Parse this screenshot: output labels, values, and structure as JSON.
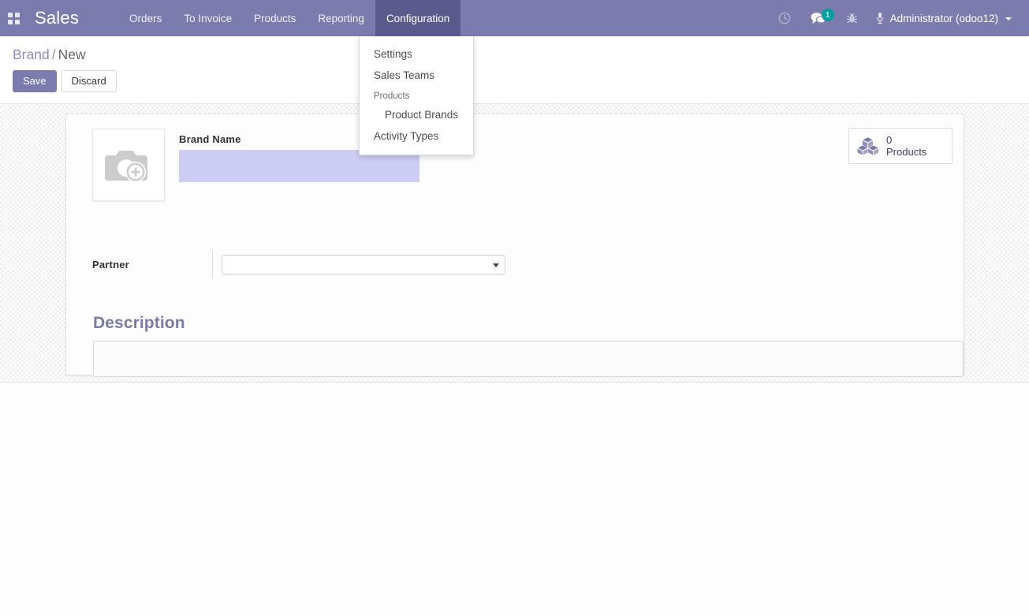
{
  "navbar": {
    "apps_icon": "apps-grid-icon",
    "app_title": "Sales",
    "menu": [
      {
        "label": "Orders",
        "active": false
      },
      {
        "label": "To Invoice",
        "active": false
      },
      {
        "label": "Products",
        "active": false
      },
      {
        "label": "Reporting",
        "active": false
      },
      {
        "label": "Configuration",
        "active": true
      }
    ],
    "systray": {
      "clock_icon": "clock-icon",
      "messages_icon": "messages-icon",
      "messages_count": "1",
      "bug_icon": "bug-icon",
      "user_icon": "user-icon",
      "user_label": "Administrator (odoo12)",
      "caret_icon": "chevron-down-icon"
    },
    "colors": {
      "navbar_bg": "#7c7bad",
      "active_menu_bg": "#5b5a8d",
      "badge_bg": "#00a09d"
    }
  },
  "dropdown": {
    "open_for": "Configuration",
    "items": [
      {
        "label": "Settings",
        "type": "item"
      },
      {
        "label": "Sales Teams",
        "type": "item"
      },
      {
        "label": "Products",
        "type": "header"
      },
      {
        "label": "Product Brands",
        "type": "sub"
      },
      {
        "label": "Activity Types",
        "type": "item"
      }
    ]
  },
  "control_panel": {
    "breadcrumb": {
      "parent": "Brand",
      "separator": "/",
      "current": "New"
    },
    "buttons": {
      "save": "Save",
      "discard": "Discard"
    }
  },
  "form": {
    "stat_button": {
      "icon": "cubes-icon",
      "value": "0",
      "label": "Products"
    },
    "image_placeholder": {
      "icon": "camera-plus-icon"
    },
    "brand_name": {
      "label": "Brand Name",
      "value": "",
      "placeholder": ""
    },
    "partner": {
      "label": "Partner",
      "value": "",
      "caret_icon": "chevron-down-icon"
    },
    "description": {
      "title": "Description",
      "value": "",
      "placeholder": ""
    },
    "colors": {
      "highlight_input_bg": "#ccccf5",
      "section_title": "#7b7ba8",
      "stat_text": "#3b3b6b"
    }
  }
}
